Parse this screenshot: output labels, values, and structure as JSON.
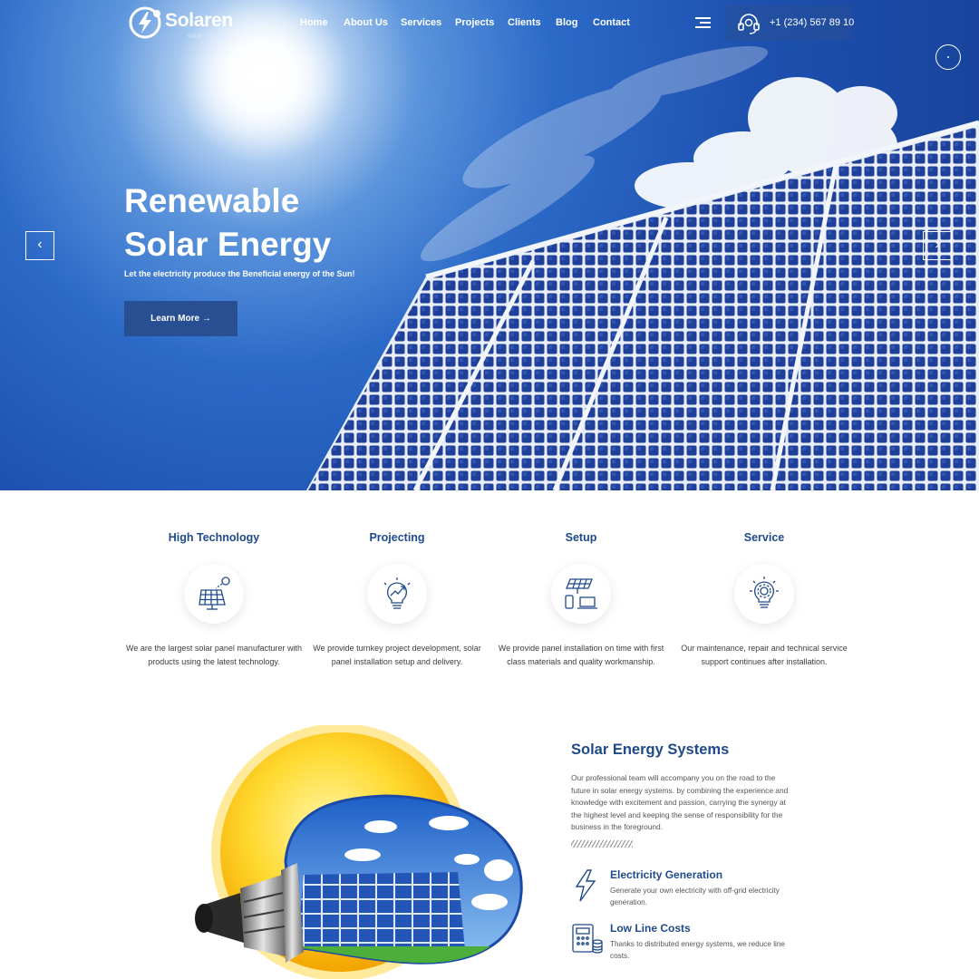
{
  "brand": {
    "name": "Solaren",
    "tagline": "solar energy"
  },
  "nav": {
    "items": [
      "Home",
      "About Us",
      "Services",
      "Projects",
      "Clients",
      "Blog",
      "Contact"
    ],
    "phone": "+1 (234) 567 89 10"
  },
  "hero": {
    "title_line1": "Renewable",
    "title_line2": "Solar Energy",
    "subtitle": "Let the electricity produce the Beneficial energy of the Sun!",
    "cta": "Learn More →",
    "prev": "‹",
    "next": "›"
  },
  "features": [
    {
      "title": "High Technology",
      "text": "We are the largest solar panel manufacturer with products using the latest technology.",
      "icon": "solar-panel-sun-icon"
    },
    {
      "title": "Projecting",
      "text": "We provide turnkey project development, solar panel installation setup and delivery.",
      "icon": "lightbulb-growth-icon"
    },
    {
      "title": "Setup",
      "text": "We provide panel installation on time with first class materials and quality workmanship.",
      "icon": "panel-devices-icon"
    },
    {
      "title": "Service",
      "text": "Our maintenance, repair and technical service support continues after installation.",
      "icon": "bulb-gear-icon"
    }
  ],
  "systems": {
    "title": "Solar Energy Systems",
    "text": "Our professional team will accompany you on the road to the future in solar energy systems. by combining the experience and knowledge with excitement and passion, carrying the synergy at the highest level and keeping the sense of responsibility for the business in the foreground.",
    "benefits": [
      {
        "title": "Electricity Generation",
        "text": "Generate your own electricity with off-grid electricity generation.",
        "icon": "lightning-bolt-icon"
      },
      {
        "title": "Low Line Costs",
        "text": "Thanks to distributed energy systems, we reduce line costs.",
        "icon": "calculator-coins-icon"
      }
    ]
  },
  "colors": {
    "primary": "#1f4a8a",
    "button": "#284f92",
    "sky": "#2c6ac8"
  }
}
